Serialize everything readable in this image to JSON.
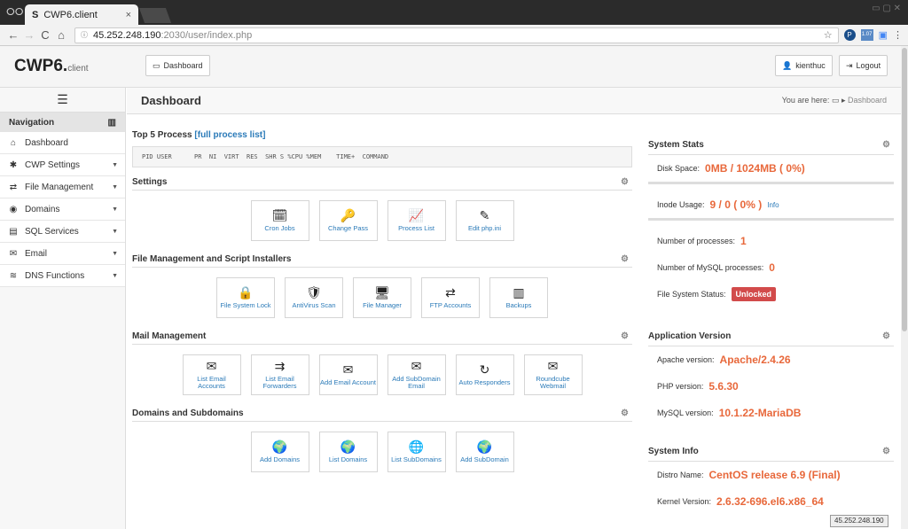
{
  "browser": {
    "tab_title": "CWP6.client",
    "url_host": "45.252.248.190",
    "url_rest": ":2030/user/index.php"
  },
  "header": {
    "logo": "CWP6.",
    "logo_sub": "client",
    "dashboard_btn": "Dashboard",
    "user_btn": "kienthuc",
    "logout_btn": "Logout"
  },
  "sidebar": {
    "nav_title": "Navigation",
    "items": [
      {
        "label": "Dashboard",
        "icon": "home-icon",
        "has_sub": false
      },
      {
        "label": "CWP Settings",
        "icon": "wrench-icon",
        "has_sub": true
      },
      {
        "label": "File Management",
        "icon": "exchange-icon",
        "has_sub": true
      },
      {
        "label": "Domains",
        "icon": "globe-icon",
        "has_sub": true
      },
      {
        "label": "SQL Services",
        "icon": "database-icon",
        "has_sub": true
      },
      {
        "label": "Email",
        "icon": "mail-icon",
        "has_sub": true
      },
      {
        "label": "DNS Functions",
        "icon": "dns-icon",
        "has_sub": true
      }
    ]
  },
  "main": {
    "title": "Dashboard",
    "you_are_here": "You are here:",
    "crumb": "Dashboard"
  },
  "process": {
    "title": "Top 5 Process",
    "link": "[full process list]",
    "header": "PID USER      PR  NI  VIRT  RES  SHR S %CPU %MEM    TIME+  COMMAND"
  },
  "sections": [
    {
      "title": "Settings",
      "items": [
        "Cron Jobs",
        "Change Pass",
        "Process List",
        "Edit php.ini"
      ]
    },
    {
      "title": "File Management and Script Installers",
      "items": [
        "File System Lock",
        "AntiVirus Scan",
        "File Manager",
        "FTP Accounts",
        "Backups"
      ]
    },
    {
      "title": "Mail Management",
      "items": [
        "List Email Accounts",
        "List Email Forwarders",
        "Add Email Account",
        "Add SubDomain Email",
        "Auto Responders",
        "Roundcube Webmail"
      ]
    },
    {
      "title": "Domains and Subdomains",
      "items": [
        "Add Domains",
        "List Domains",
        "List SubDomains",
        "Add SubDomain"
      ]
    }
  ],
  "stats": {
    "title": "System Stats",
    "disk_label": "Disk Space:",
    "disk_value": "0MB / 1024MB ( 0%)",
    "inode_label": "Inode Usage:",
    "inode_value": "9 / 0 ( 0% )",
    "inode_link": "Info",
    "proc_label": "Number of processes:",
    "proc_value": "1",
    "mysql_label": "Number of MySQL processes:",
    "mysql_value": "0",
    "fs_label": "File System Status:",
    "fs_value": "Unlocked"
  },
  "appver": {
    "title": "Application Version",
    "apache_label": "Apache version:",
    "apache_value": "Apache/2.4.26",
    "php_label": "PHP version:",
    "php_value": "5.6.30",
    "mysql_label": "MySQL version:",
    "mysql_value": "10.1.22-MariaDB"
  },
  "sysinfo": {
    "title": "System Info",
    "distro_label": "Distro Name:",
    "distro_value": "CentOS release 6.9 (Final)",
    "kernel_label": "Kernel Version:",
    "kernel_value": "2.6.32-696.el6.x86_64"
  },
  "ip_badge": "45.252.248.190"
}
